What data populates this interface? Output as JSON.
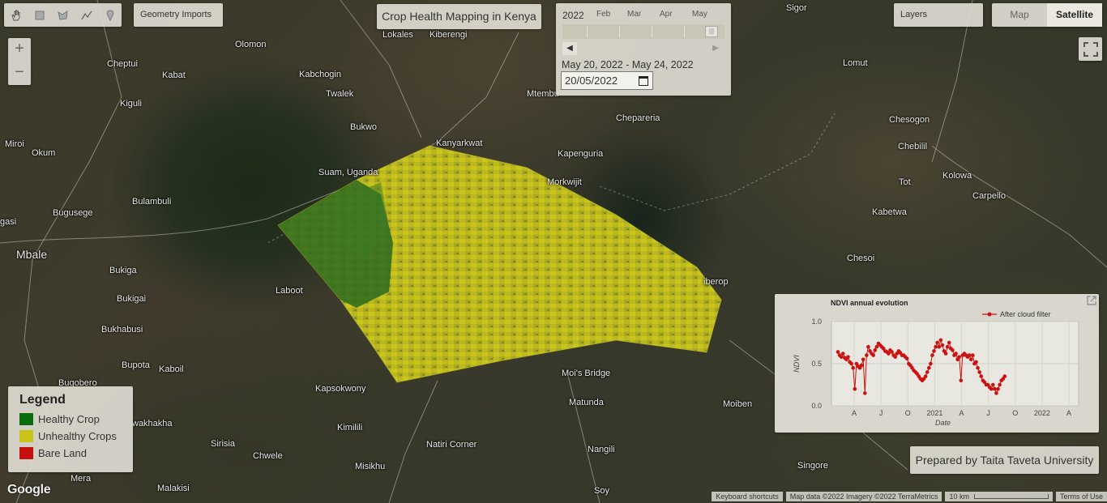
{
  "app": {
    "title": "Crop Health Mapping in Kenya"
  },
  "toolbar": {
    "tools": [
      "hand-icon",
      "rectangle-icon",
      "polygon-icon",
      "line-icon",
      "point-icon"
    ],
    "geometry_imports": "Geometry Imports",
    "layers": "Layers",
    "map_type": {
      "map": "Map",
      "satellite": "Satellite",
      "selected": "Satellite"
    }
  },
  "zoom": {
    "in": "+",
    "out": "−"
  },
  "date_panel": {
    "year": "2022",
    "months": [
      "Feb",
      "Mar",
      "Apr",
      "May"
    ],
    "range_text": "May 20, 2022 - May 24, 2022",
    "input_value": "20/05/2022"
  },
  "legend": {
    "title": "Legend",
    "items": [
      {
        "label": "Healthy Crop",
        "color": "#0a6f0a"
      },
      {
        "label": "Unhealthy Crops",
        "color": "#c9c41a"
      },
      {
        "label": "Bare Land",
        "color": "#c81010"
      }
    ]
  },
  "chart_panel": {
    "chart_data": {
      "type": "line",
      "title": "NDVI annual evolution",
      "xlabel": "Date",
      "ylabel": "NDVI",
      "ylim": [
        0.0,
        1.0
      ],
      "y_ticks": [
        "0.0",
        "0.5",
        "1.0"
      ],
      "x_ticks": [
        "A",
        "J",
        "O",
        "2021",
        "A",
        "J",
        "O",
        "2022",
        "A"
      ],
      "legend_position": "top-right",
      "grid": true,
      "series": [
        {
          "name": "After cloud filter",
          "color": "#cc1111",
          "x": [
            0,
            2,
            4,
            6,
            8,
            10,
            12,
            14,
            16,
            18,
            20,
            22,
            24,
            26,
            28,
            30,
            32,
            34,
            36,
            38,
            40,
            42,
            44,
            46,
            48,
            50,
            52,
            54,
            56,
            58,
            60,
            62,
            64,
            66,
            68,
            70,
            72,
            74,
            76,
            78,
            80,
            82,
            84,
            86,
            88,
            90,
            92,
            94,
            96,
            98,
            100,
            102,
            104,
            106,
            108,
            110,
            112,
            114,
            116,
            118,
            120,
            122,
            124,
            126,
            128,
            130,
            132,
            134,
            136,
            138,
            140,
            142,
            144,
            146,
            148,
            150,
            152,
            154,
            156,
            158,
            160,
            162,
            164,
            166,
            168,
            170,
            172,
            174,
            176,
            178,
            180,
            182,
            184,
            186,
            188,
            190,
            192,
            194,
            196,
            198,
            200,
            202,
            204,
            206,
            208,
            210,
            212,
            214,
            216,
            218,
            220,
            222,
            224,
            226,
            228,
            230,
            232,
            234,
            236,
            238,
            240,
            242,
            244,
            246,
            248,
            250,
            252,
            254,
            256,
            258,
            260,
            262,
            264,
            266,
            268,
            270,
            272,
            274,
            276,
            278
          ],
          "values": [
            0.64,
            0.6,
            0.58,
            0.62,
            0.57,
            0.55,
            0.58,
            0.52,
            0.5,
            0.45,
            0.2,
            0.5,
            0.47,
            0.45,
            0.48,
            0.55,
            0.15,
            0.6,
            0.7,
            0.65,
            0.62,
            0.6,
            0.66,
            0.7,
            0.74,
            0.72,
            0.7,
            0.68,
            0.65,
            0.64,
            0.62,
            0.66,
            0.64,
            0.6,
            0.58,
            0.62,
            0.65,
            0.63,
            0.6,
            0.6,
            0.58,
            0.56,
            0.5,
            0.48,
            0.45,
            0.42,
            0.4,
            0.38,
            0.35,
            0.32,
            0.3,
            0.32,
            0.35,
            0.4,
            0.45,
            0.5,
            0.6,
            0.65,
            0.7,
            0.75,
            0.7,
            0.78,
            0.72,
            0.65,
            0.62,
            0.7,
            0.75,
            0.68,
            0.66,
            0.6,
            0.62,
            0.55,
            0.58,
            0.3,
            0.6,
            0.62,
            0.6,
            0.58,
            0.6,
            0.55,
            0.6,
            0.5,
            0.52,
            0.45,
            0.4,
            0.35,
            0.3,
            0.28,
            0.25,
            0.25,
            0.22,
            0.2,
            0.25,
            0.2,
            0.15,
            0.2,
            0.25,
            0.3,
            0.32,
            0.35
          ]
        }
      ]
    }
  },
  "credit": "Prepared by Taita Taveta University",
  "places": [
    {
      "name": "Lokales",
      "big": false
    },
    {
      "name": "Kiberengi",
      "big": false
    },
    {
      "name": "Olomon",
      "big": false
    },
    {
      "name": "Cheptui",
      "big": false
    },
    {
      "name": "Kabat",
      "big": false
    },
    {
      "name": "Kabchogin",
      "big": false
    },
    {
      "name": "Twalek",
      "big": false
    },
    {
      "name": "Kiguli",
      "big": false
    },
    {
      "name": "Bukwo",
      "big": false
    },
    {
      "name": "Mtembu",
      "big": false
    },
    {
      "name": "Kanyarkwat",
      "big": false
    },
    {
      "name": "Chepareria",
      "big": false
    },
    {
      "name": "Miroi",
      "big": false
    },
    {
      "name": "Okum",
      "big": false
    },
    {
      "name": "Suam, Uganda",
      "big": false
    },
    {
      "name": "Kapenguria",
      "big": false
    },
    {
      "name": "Morkwijit",
      "big": false
    },
    {
      "name": "Bulambuli",
      "big": false
    },
    {
      "name": "Bugusege",
      "big": false
    },
    {
      "name": "Mbale",
      "big": true
    },
    {
      "name": "Bukiga",
      "big": false
    },
    {
      "name": "Bukigai",
      "big": false
    },
    {
      "name": "Laboot",
      "big": false
    },
    {
      "name": "Bukhabusi",
      "big": false
    },
    {
      "name": "Bupota",
      "big": false
    },
    {
      "name": "Kaboil",
      "big": false
    },
    {
      "name": "Bugobero",
      "big": false
    },
    {
      "name": "Kapsokwony",
      "big": false
    },
    {
      "name": "Moi's Bridge",
      "big": false
    },
    {
      "name": "Matunda",
      "big": false
    },
    {
      "name": "Kimilili",
      "big": false
    },
    {
      "name": "Sirisia",
      "big": false
    },
    {
      "name": "Chwele",
      "big": false
    },
    {
      "name": "Natiri Corner",
      "big": false
    },
    {
      "name": "Nangili",
      "big": false
    },
    {
      "name": "Misikhu",
      "big": false
    },
    {
      "name": "Mera",
      "big": false
    },
    {
      "name": "Malakisi",
      "big": false
    },
    {
      "name": "Soy",
      "big": false
    },
    {
      "name": "Moiben",
      "big": false
    },
    {
      "name": "Singore",
      "big": false
    },
    {
      "name": "Sigor",
      "big": false
    },
    {
      "name": "Lomut",
      "big": false
    },
    {
      "name": "Chesogon",
      "big": false
    },
    {
      "name": "Chebilil",
      "big": false
    },
    {
      "name": "Tot",
      "big": false
    },
    {
      "name": "Kolowa",
      "big": false
    },
    {
      "name": "Carpello",
      "big": false
    },
    {
      "name": "Kabetwa",
      "big": false
    },
    {
      "name": "Chesoi",
      "big": false
    },
    {
      "name": "gasi",
      "big": false
    },
    {
      "name": "wakhakha",
      "big": false
    },
    {
      "name": "iberop",
      "big": false
    }
  ],
  "footer": {
    "shortcuts": "Keyboard shortcuts",
    "attribution": "Map data ©2022 Imagery ©2022 TerraMetrics",
    "scale": "10 km",
    "terms": "Terms of Use"
  },
  "google_logo": "Google"
}
